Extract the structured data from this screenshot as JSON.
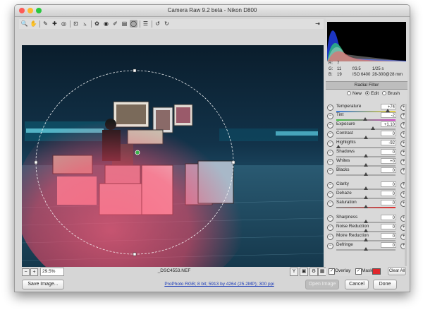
{
  "window": {
    "title": "Camera Raw 9.2 beta  -  Nikon D800",
    "traffic_colors": [
      "#fd5b56",
      "#fdbb2f",
      "#28c83e"
    ]
  },
  "toolbar": {
    "tools": [
      "zoom-icon",
      "hand-icon",
      "white-balance-icon",
      "color-sampler-icon",
      "target-adjustment-icon",
      "crop-icon",
      "straighten-icon",
      "spot-removal-icon",
      "red-eye-icon",
      "adjustment-brush-icon",
      "graduated-filter-icon",
      "radial-filter-icon",
      "presets-icon",
      "rotate-ccw-icon",
      "rotate-cw-icon"
    ],
    "glyphs": [
      "🔍",
      "✋",
      "✎",
      "✚",
      "◎",
      "⊡",
      "⦣",
      "✿",
      "◉",
      "✐",
      "▤",
      "◯",
      "☰",
      "↺",
      "↻"
    ],
    "active_tool": "radial-filter-icon",
    "open_panel_icon": "⇥"
  },
  "readout": {
    "r_label": "R:",
    "r_val": "7",
    "g_label": "G:",
    "g_val": "11",
    "b_label": "B:",
    "b_val": "19",
    "aperture": "f/3.5",
    "shutter": "1/25 s",
    "iso": "ISO 6400",
    "lens": "28-300@28 mm"
  },
  "radial_filter": {
    "panel_title": "Radial Filter",
    "modes": [
      "New",
      "Edit",
      "Brush"
    ],
    "selected_mode": "Edit",
    "sliders": [
      {
        "label": "Temperature",
        "value": "+74",
        "level": 0.87,
        "track": "temp"
      },
      {
        "label": "Tint",
        "value": "-2",
        "level": 0.49,
        "track": "tint"
      },
      {
        "label": "Exposure",
        "value": "+1.10",
        "level": 0.62,
        "track": "grey"
      },
      {
        "label": "Contrast",
        "value": "0",
        "level": 0.5,
        "track": "grey"
      },
      {
        "label": "Highlights",
        "value": "-92",
        "level": 0.04,
        "track": "grey"
      },
      {
        "label": "Shadows",
        "value": "0",
        "level": 0.5,
        "track": "grey"
      },
      {
        "label": "Whites",
        "value": "+0",
        "level": 0.5,
        "track": "grey"
      },
      {
        "label": "Blacks",
        "value": "0",
        "level": 0.5,
        "track": "grey"
      },
      {
        "label": "Clarity",
        "value": "0",
        "level": 0.5,
        "track": "grey"
      },
      {
        "label": "Dehaze",
        "value": "0",
        "level": 0.5,
        "track": "grey"
      },
      {
        "label": "Saturation",
        "value": "0",
        "level": 0.5,
        "track": "sat"
      },
      {
        "label": "Sharpness",
        "value": "0",
        "level": 0.5,
        "track": "grey"
      },
      {
        "label": "Noise Reduction",
        "value": "0",
        "level": 0.5,
        "track": "grey"
      },
      {
        "label": "Moire Reduction",
        "value": "0",
        "level": 0.5,
        "track": "grey"
      },
      {
        "label": "Defringe",
        "value": "0",
        "level": 0.5,
        "track": "grey"
      }
    ],
    "overlay_label": "Overlay",
    "overlay_checked": true,
    "mask_label": "Mask",
    "mask_checked": true,
    "mask_color": "#e0262b",
    "clear_all_label": "Clear All"
  },
  "status": {
    "zoom_minus": "−",
    "zoom_plus": "+",
    "zoom": "29.5%",
    "filename": "_DSC4553.NEF",
    "view_glyphs": [
      "Y",
      "▣",
      "⚙",
      "▦"
    ]
  },
  "footer": {
    "save_label": "Save Image...",
    "workflow_link": "ProPhoto RGB; 8 bit; 5913 by 4264 (25.2MP); 300 ppi",
    "open_label": "Open Image",
    "cancel_label": "Cancel",
    "done_label": "Done"
  }
}
